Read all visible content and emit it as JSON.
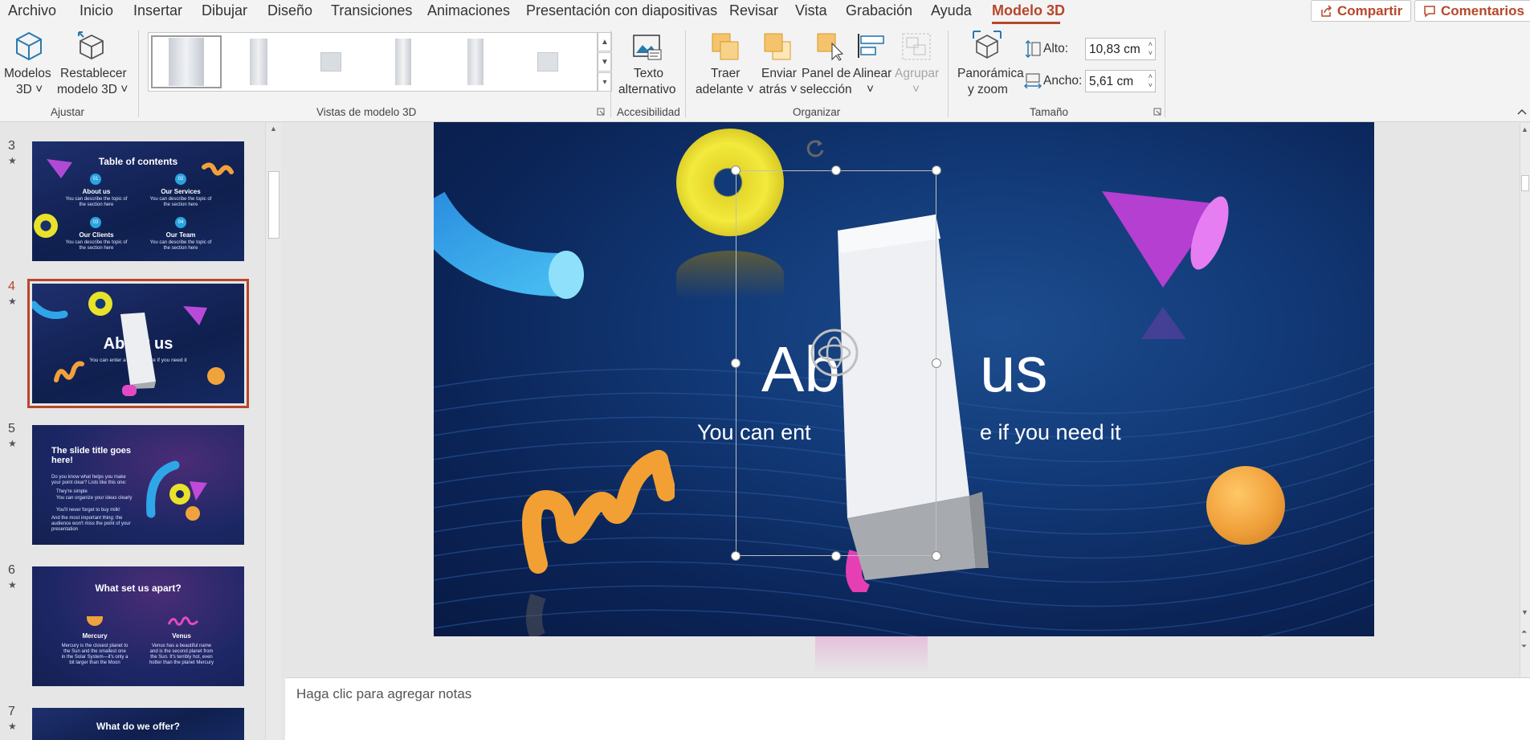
{
  "tabs": [
    "Archivo",
    "Inicio",
    "Insertar",
    "Dibujar",
    "Diseño",
    "Transiciones",
    "Animaciones",
    "Presentación con diapositivas",
    "Revisar",
    "Vista",
    "Grabación",
    "Ayuda",
    "Modelo 3D"
  ],
  "share_label": "Compartir",
  "comments_label": "Comentarios",
  "ribbon": {
    "modelos_l1": "Modelos",
    "modelos_l2": "3D ˅",
    "restablecer_l1": "Restablecer",
    "restablecer_l2": "modelo 3D ˅",
    "group_ajustar": "Ajustar",
    "group_vistas": "Vistas de modelo 3D",
    "texto_l1": "Texto",
    "texto_l2": "alternativo",
    "group_accesibilidad": "Accesibilidad",
    "traer_l1": "Traer",
    "traer_l2": "adelante ˅",
    "enviar_l1": "Enviar",
    "enviar_l2": "atrás ˅",
    "panel_l1": "Panel de",
    "panel_l2": "selección",
    "alinear_l1": "Alinear",
    "alinear_l2": "˅",
    "agrupar_l1": "Agrupar",
    "agrupar_l2": "˅",
    "group_organizar": "Organizar",
    "panoramica_l1": "Panorámica",
    "panoramica_l2": "y zoom",
    "alto_label": "Alto:",
    "alto_value": "10,83 cm",
    "ancho_label": "Ancho:",
    "ancho_value": "5,61 cm",
    "group_tamano": "Tamaño"
  },
  "slides": [
    {
      "num": "3",
      "title": "Table of contents",
      "items": [
        {
          "n": "01",
          "t": "About us",
          "d": "You can describe the topic of the section here"
        },
        {
          "n": "02",
          "t": "Our Services",
          "d": "You can describe the topic of the section here"
        },
        {
          "n": "03",
          "t": "Our Clients",
          "d": "You can describe the topic of the section here"
        },
        {
          "n": "04",
          "t": "Our Team",
          "d": "You can describe the topic of the section here"
        }
      ]
    },
    {
      "num": "4",
      "title": "About us",
      "sub": "You can enter a subtitle here if you need it"
    },
    {
      "num": "5",
      "title": "The slide title goes here!",
      "p1": "Do you know what helps you make your point clear? Lists like this one:",
      "b1": "They're simple",
      "b2": "You can organize your ideas clearly",
      "b3": "You'll never forget to buy milk!",
      "p2": "And the most important thing: the audience won't miss the point of your presentation"
    },
    {
      "num": "6",
      "title": "What set us apart?",
      "c1t": "Mercury",
      "c1d": "Mercury is the closest planet to the Sun and the smallest one in the Solar System—it's only a bit larger than the Moon",
      "c2t": "Venus",
      "c2d": "Venus has a beautiful name and is the second planet from the Sun. It's terribly hot, even hotter than the planet Mercury"
    },
    {
      "num": "7",
      "title": "What do we offer?"
    }
  ],
  "main_slide": {
    "title_left": "Ab",
    "title_right": "us",
    "sub_left": "You can ent",
    "sub_right": "e if you need it"
  },
  "notes_placeholder": "Haga clic para agregar notas"
}
